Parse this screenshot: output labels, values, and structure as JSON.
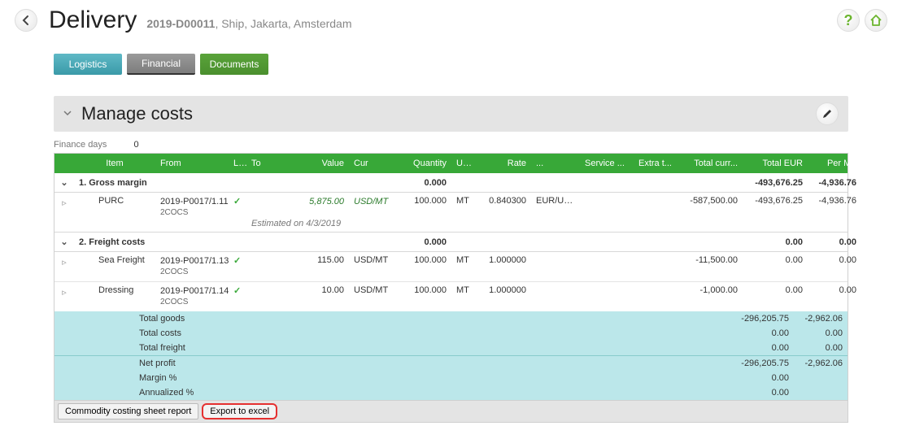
{
  "header": {
    "title": "Delivery",
    "code": "2019-D00011",
    "subtitle_suffix": ", Ship, Jakarta, Amsterdam"
  },
  "tabs": {
    "logistics": "Logistics",
    "financial": "Financial",
    "documents": "Documents"
  },
  "section": {
    "title": "Manage costs",
    "finance_days_label": "Finance days",
    "finance_days_value": "0"
  },
  "columns": {
    "item": "Item",
    "from": "From",
    "l": "L...",
    "to": "To",
    "value": "Value",
    "cur": "Cur",
    "quantity": "Quantity",
    "u": "U...",
    "rate": "Rate",
    "rateu": "...",
    "service": "Service ...",
    "extra": "Extra t...",
    "total_curr": "Total curr...",
    "total_eur": "Total EUR",
    "per_mt": "Per MT"
  },
  "groups": {
    "g1": {
      "title": "1. Gross margin",
      "qty": "0.000",
      "total_eur": "-493,676.25",
      "per_mt": "-4,936.76"
    },
    "g2": {
      "title": "2. Freight costs",
      "qty": "0.000",
      "total_eur": "0.00",
      "per_mt": "0.00"
    }
  },
  "rows": {
    "purc": {
      "item": "PURC",
      "from_line1": "2019-P0017/1.11",
      "from_line2": "2COCS",
      "value": "5,875.00",
      "cur": "USD/MT",
      "estimated": "Estimated on 4/3/2019",
      "qty": "100.000",
      "qu": "MT",
      "rate": "0.840300",
      "rateu": "EUR/USD",
      "total_curr": "-587,500.00",
      "total_eur": "-493,676.25",
      "per_mt": "-4,936.76"
    },
    "sea": {
      "item": "Sea Freight",
      "from_line1": "2019-P0017/1.13",
      "from_line2": "2COCS",
      "value": "115.00",
      "cur": "USD/MT",
      "qty": "100.000",
      "qu": "MT",
      "rate": "1.000000",
      "total_curr": "-11,500.00",
      "total_eur": "0.00",
      "per_mt": "0.00"
    },
    "dressing": {
      "item": "Dressing",
      "from_line1": "2019-P0017/1.14",
      "from_line2": "2COCS",
      "value": "10.00",
      "cur": "USD/MT",
      "qty": "100.000",
      "qu": "MT",
      "rate": "1.000000",
      "total_curr": "-1,000.00",
      "total_eur": "0.00",
      "per_mt": "0.00"
    }
  },
  "summary": {
    "total_goods": {
      "label": "Total goods",
      "eur": "-296,205.75",
      "pmt": "-2,962.06"
    },
    "total_costs": {
      "label": "Total costs",
      "eur": "0.00",
      "pmt": "0.00"
    },
    "total_freight": {
      "label": "Total freight",
      "eur": "0.00",
      "pmt": "0.00"
    },
    "net_profit": {
      "label": "Net profit",
      "eur": "-296,205.75",
      "pmt": "-2,962.06"
    },
    "margin": {
      "label": "Margin %",
      "eur": "0.00",
      "pmt": ""
    },
    "annualized": {
      "label": "Annualized %",
      "eur": "0.00",
      "pmt": ""
    }
  },
  "footer": {
    "report": "Commodity costing sheet report",
    "export": "Export to excel"
  },
  "icons": {
    "help": "?",
    "check": "✓",
    "expand_down": "⌄",
    "expand_right": "▹"
  }
}
